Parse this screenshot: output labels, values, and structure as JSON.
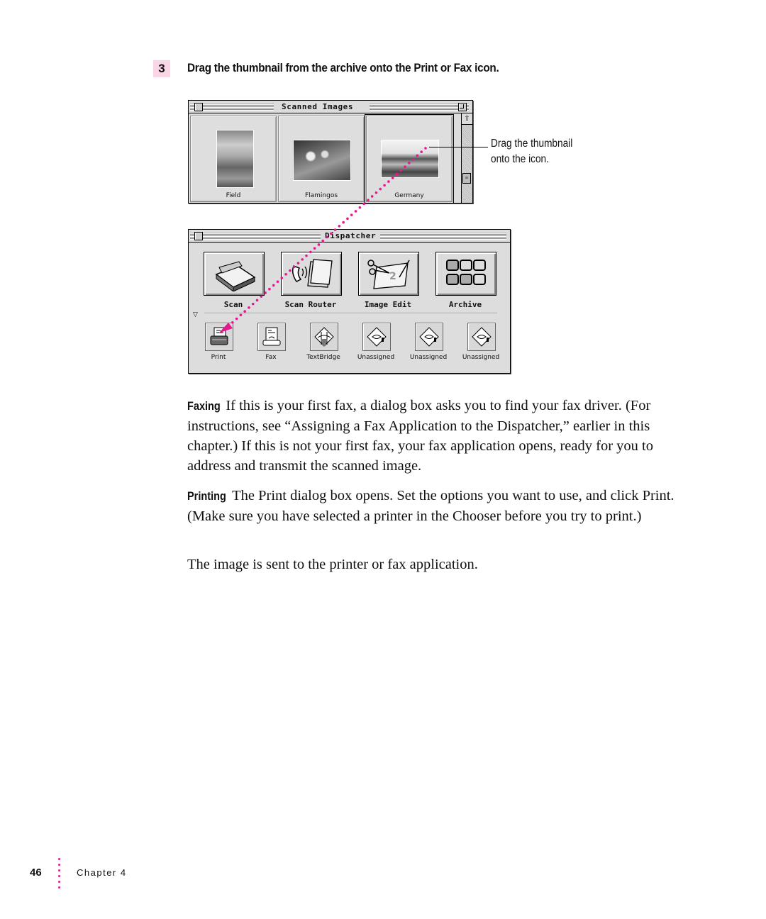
{
  "step": {
    "number": "3",
    "instruction": "Drag the thumbnail from the archive onto the Print or Fax icon."
  },
  "scanned_window": {
    "title": "Scanned Images",
    "thumbnails": [
      {
        "label": "Field",
        "selected": false
      },
      {
        "label": "Flamingos",
        "selected": false
      },
      {
        "label": "Germany",
        "selected": true
      }
    ]
  },
  "callout": {
    "line1": "Drag the thumbnail",
    "line2": "onto the icon."
  },
  "dispatcher_window": {
    "title": "Dispatcher",
    "main_buttons": [
      {
        "label": "Scan",
        "icon": "scanner-icon"
      },
      {
        "label": "Scan Router",
        "icon": "scan-router-icon"
      },
      {
        "label": "Image Edit",
        "icon": "image-edit-icon"
      },
      {
        "label": "Archive",
        "icon": "archive-icon"
      }
    ],
    "drop_targets": [
      {
        "label": "Print",
        "icon": "printer-icon"
      },
      {
        "label": "Fax",
        "icon": "fax-icon"
      },
      {
        "label": "TextBridge",
        "icon": "textbridge-icon"
      },
      {
        "label": "Unassigned",
        "icon": "unassigned-icon"
      },
      {
        "label": "Unassigned",
        "icon": "unassigned-icon"
      },
      {
        "label": "Unassigned",
        "icon": "unassigned-icon"
      }
    ]
  },
  "drag_path_color": "#e8168f",
  "paragraphs": {
    "faxing": {
      "runin": "Faxing",
      "text": "If this is your first fax, a dialog box asks you to find your fax driver. (For instructions, see “Assigning a Fax Application to the Dispatcher,” earlier in this chapter.) If this is not your first fax, your fax application opens, ready for you to address and transmit the scanned image."
    },
    "printing": {
      "runin": "Printing",
      "text": "The Print dialog box opens. Set the options you want to use, and click Print. (Make sure you have selected a printer in the Chooser before you try to print.)"
    },
    "result": "The image is sent to the printer or fax application."
  },
  "footer": {
    "page_number": "46",
    "chapter": "Chapter 4"
  }
}
